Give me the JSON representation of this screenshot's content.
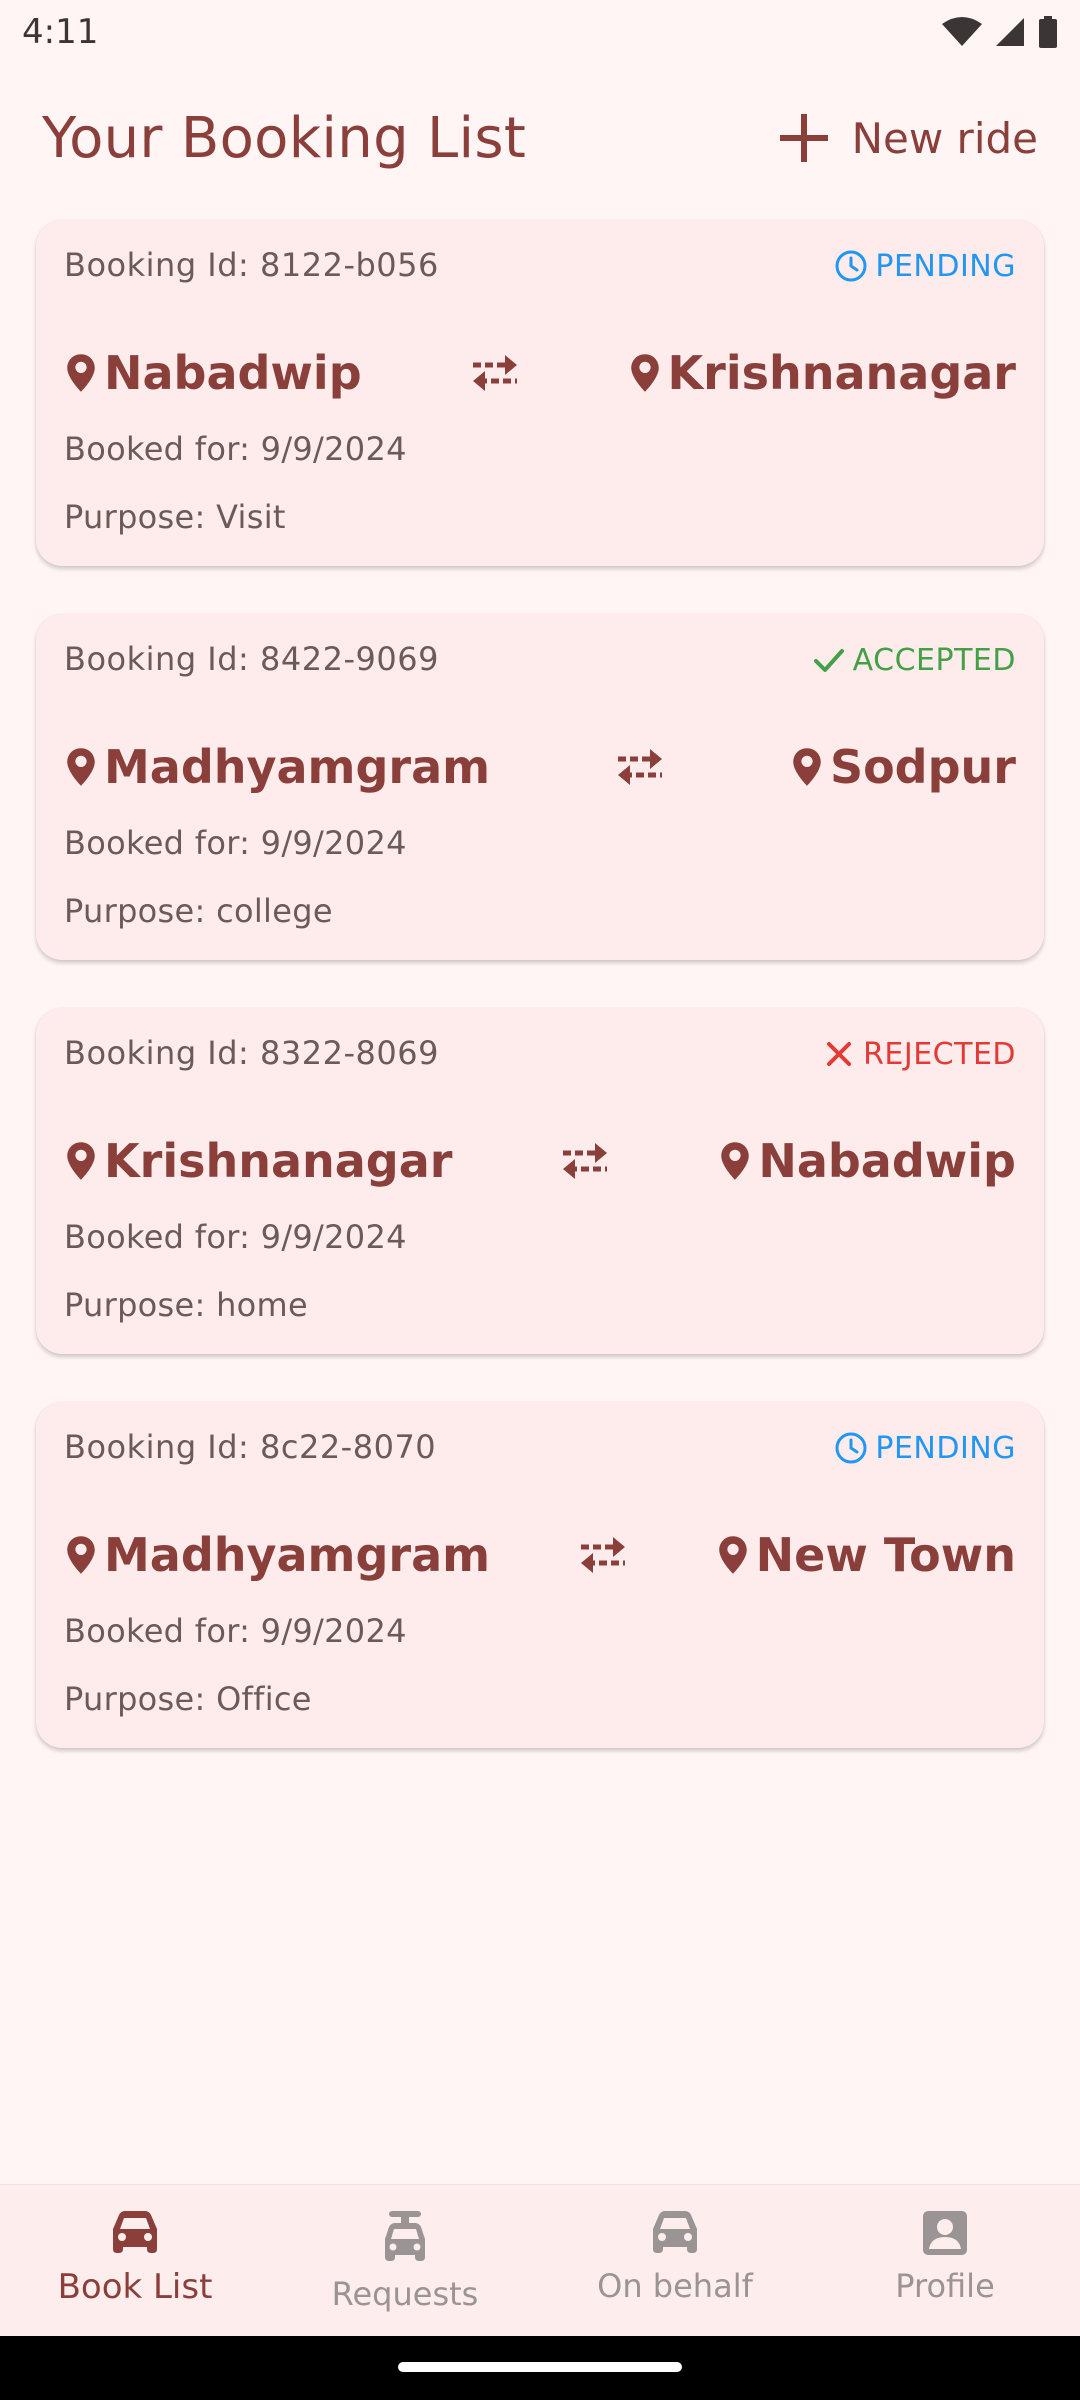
{
  "status_bar": {
    "time": "4:11"
  },
  "header": {
    "title": "Your Booking List",
    "new_ride_label": "New ride"
  },
  "bookings": [
    {
      "id": "Booking Id: 8122-b056",
      "status": "PENDING",
      "from": "Nabadwip",
      "to": "Krishnanagar",
      "booked_for": "Booked for: 9/9/2024",
      "purpose": "Purpose: Visit"
    },
    {
      "id": "Booking Id: 8422-9069",
      "status": "ACCEPTED",
      "from": "Madhyamgram",
      "to": "Sodpur",
      "booked_for": "Booked for: 9/9/2024",
      "purpose": "Purpose: college"
    },
    {
      "id": "Booking Id: 8322-8069",
      "status": "REJECTED",
      "from": "Krishnanagar",
      "to": "Nabadwip",
      "booked_for": "Booked for: 9/9/2024",
      "purpose": "Purpose: home"
    },
    {
      "id": "Booking Id: 8c22-8070",
      "status": "PENDING",
      "from": "Madhyamgram",
      "to": "New Town",
      "booked_for": "Booked for: 9/9/2024",
      "purpose": "Purpose: Office"
    }
  ],
  "status_colors": {
    "PENDING": "#2196f3",
    "ACCEPTED": "#43a047",
    "REJECTED": "#e53935"
  },
  "bottom_nav": [
    {
      "label": "Book List",
      "icon": "car-icon",
      "active": true
    },
    {
      "label": "Requests",
      "icon": "car-seat-icon",
      "active": false
    },
    {
      "label": "On behalf",
      "icon": "car-icon",
      "active": false
    },
    {
      "label": "Profile",
      "icon": "account-box-icon",
      "active": false
    }
  ]
}
